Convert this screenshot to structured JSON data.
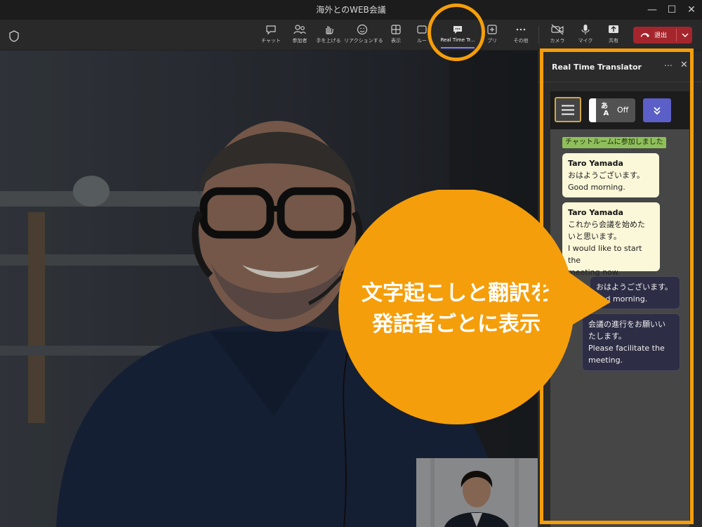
{
  "window": {
    "title": "海外とのWEB会議"
  },
  "toolbar": {
    "chat": "チャット",
    "people": "参加者",
    "raise_hand": "手を上げる",
    "reactions": "リアクションする",
    "view": "表示",
    "rooms": "ルー",
    "rtt": "Real Time Tr...",
    "apps": "プリ",
    "more": "その他",
    "camera": "カメラ",
    "mic": "マイク",
    "share": "共有",
    "leave": "退出"
  },
  "panel": {
    "title": "Real Time Translator",
    "toggle_label": "Off",
    "system_message": "チャットルームに参加しました",
    "messages": [
      {
        "speaker": "Taro Yamada",
        "original": "おはようございます。",
        "translation": "Good morning."
      },
      {
        "speaker": "Taro Yamada",
        "original_line1": "これから会議を始めた",
        "original_line2": "いと思います。",
        "translation_line1": "I would like to start the",
        "translation_line2": "meeting now."
      },
      {
        "original": "おはようございます。",
        "translation": "ood morning."
      },
      {
        "original_line1": "会議の進行をお願いい",
        "original_line2": "たします。",
        "translation_line1": "Please facilitate the",
        "translation_line2": "meeting."
      }
    ]
  },
  "callout": {
    "line1": "文字起こしと翻訳を",
    "line2": "発話者ごとに表示"
  },
  "colors": {
    "highlight_orange": "#F59E0B",
    "leave_red": "#A4262C",
    "accent_purple": "#5B5FC7"
  }
}
